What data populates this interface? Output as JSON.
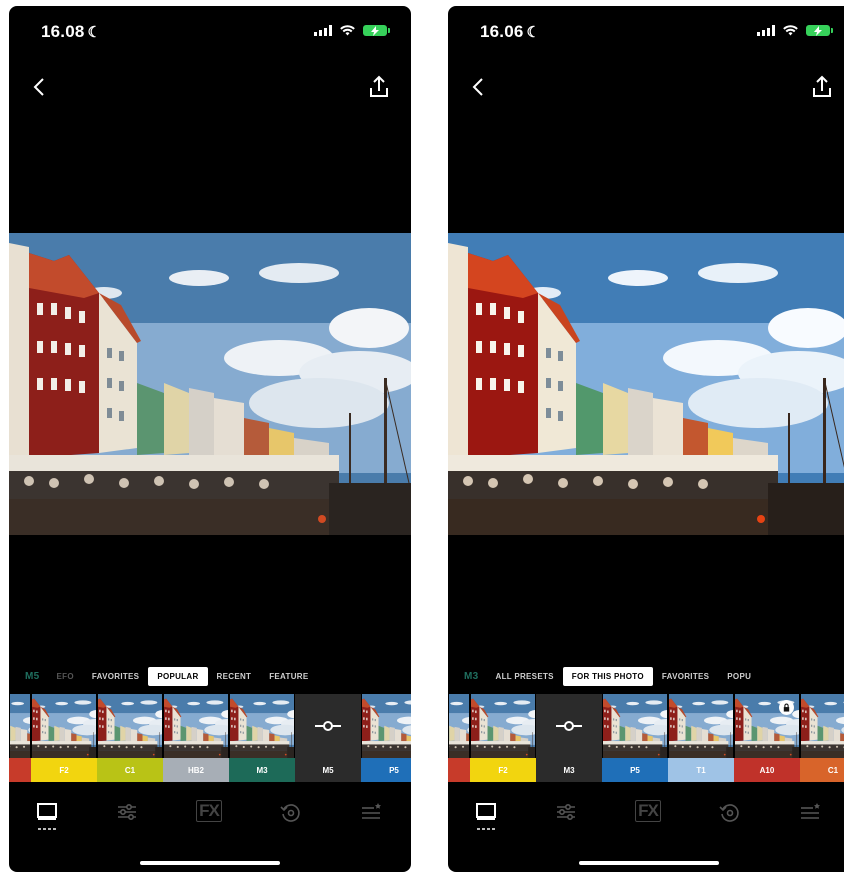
{
  "accent": "#1f6f5f",
  "icons": {
    "back": "chevron-left-icon",
    "share": "share-icon",
    "presets_tool": "presets-icon",
    "adjust_tool": "sliders-icon",
    "fx_tool": "fx-icon",
    "history_tool": "history-icon",
    "recipes_tool": "recipes-icon"
  },
  "left": {
    "status": {
      "time": "16.08",
      "moon": "☾"
    },
    "tabs": {
      "t0": "M5",
      "t1": "EFO",
      "t2": "FAVORITES",
      "t3": "POPULAR",
      "t4": "RECENT",
      "t5": "FEATURE"
    },
    "presets": [
      {
        "label": "",
        "color": "#c73b2a"
      },
      {
        "label": "F2",
        "color": "#f2d50f"
      },
      {
        "label": "C1",
        "color": "#b9c316"
      },
      {
        "label": "HB2",
        "color": "#a7aeb6"
      },
      {
        "label": "M3",
        "color": "#1d6a58"
      },
      {
        "label": "M5",
        "color": "#2b2b2b"
      },
      {
        "label": "P5",
        "color": "#1f6fb8"
      }
    ],
    "toolbar": {
      "fx_label": "FX"
    }
  },
  "right": {
    "status": {
      "time": "16.06",
      "moon": "☾"
    },
    "tabs": {
      "t0": "M3",
      "t1": "ALL PRESETS",
      "t2": "FOR THIS PHOTO",
      "t3": "FAVORITES",
      "t4": "POPU"
    },
    "presets": [
      {
        "label": "",
        "color": "#c73b2a"
      },
      {
        "label": "F2",
        "color": "#f2d50f"
      },
      {
        "label": "M3",
        "color": "#2b2b2b"
      },
      {
        "label": "P5",
        "color": "#1f6fb8"
      },
      {
        "label": "T1",
        "color": "#9fc3e6"
      },
      {
        "label": "A10",
        "color": "#c0322a"
      },
      {
        "label": "C1",
        "color": "#d8642a"
      }
    ],
    "toolbar": {
      "fx_label": "FX"
    }
  }
}
